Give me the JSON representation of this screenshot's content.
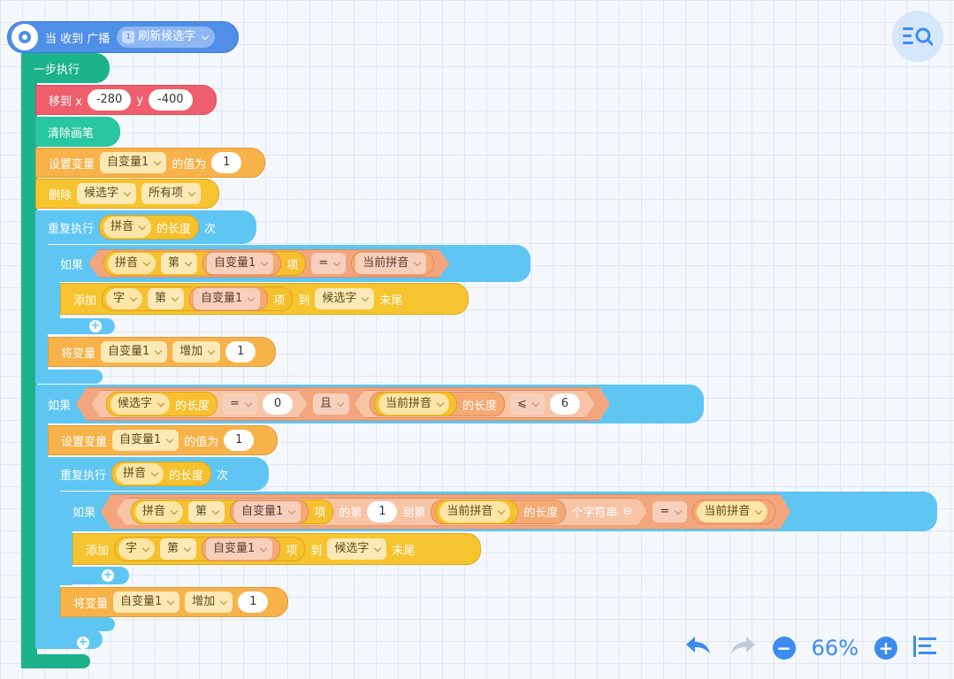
{
  "hat": {
    "label": "当 收到 广播",
    "message_badge": "1",
    "message": "刷新候选字"
  },
  "step_block": "一步执行",
  "move": {
    "label": "移到 x",
    "x": "-280",
    "ylabel": "y",
    "y": "-400"
  },
  "clear": "清除画笔",
  "set1": {
    "label": "设置变量",
    "var": "自变量1",
    "mid": "的值为",
    "value": "1"
  },
  "delete": {
    "label": "删除",
    "list": "候选字",
    "item": "所有项"
  },
  "repeat1": {
    "label": "重复执行",
    "var": "拼音",
    "len": "的长度",
    "times": "次"
  },
  "if1": {
    "label": "如果",
    "list": "拼音",
    "nth": "第",
    "var": "自变量1",
    "item": "项",
    "op": "=",
    "right": "当前拼音"
  },
  "add1": {
    "label": "添加",
    "list": "字",
    "nth": "第",
    "var": "自变量1",
    "item": "项",
    "to": "到",
    "target": "候选字",
    "end": "末尾"
  },
  "change1": {
    "label": "将变量",
    "var": "自变量1",
    "op": "增加",
    "value": "1"
  },
  "if2": {
    "label": "如果",
    "list": "候选字",
    "len": "的长度",
    "op": "=",
    "val": "0",
    "and": "且",
    "var2": "当前拼音",
    "len2": "的长度",
    "op2": "⩽",
    "val2": "6"
  },
  "set2": {
    "label": "设置变量",
    "var": "自变量1",
    "mid": "的值为",
    "value": "1"
  },
  "repeat2": {
    "label": "重复执行",
    "var": "拼音",
    "len": "的长度",
    "times": "次"
  },
  "if3": {
    "label": "如果",
    "list": "拼音",
    "nth": "第",
    "var": "自变量1",
    "item": "项",
    "from": "的第",
    "n1": "1",
    "to": "到第",
    "var2": "当前拼音",
    "len": "的长度",
    "substr": "个字符串",
    "op": "=",
    "right": "当前拼音"
  },
  "add2": {
    "label": "添加",
    "list": "字",
    "nth": "第",
    "var": "自变量1",
    "item": "项",
    "to": "到",
    "target": "候选字",
    "end": "末尾"
  },
  "change2": {
    "label": "将变量",
    "var": "自变量1",
    "op": "增加",
    "value": "1"
  },
  "zoom": {
    "level": "66%"
  },
  "colors": {
    "accent": "#3c8cf0",
    "control": "#5ec8f4",
    "data": "#f7b24a",
    "motion": "#ef5e6c"
  }
}
